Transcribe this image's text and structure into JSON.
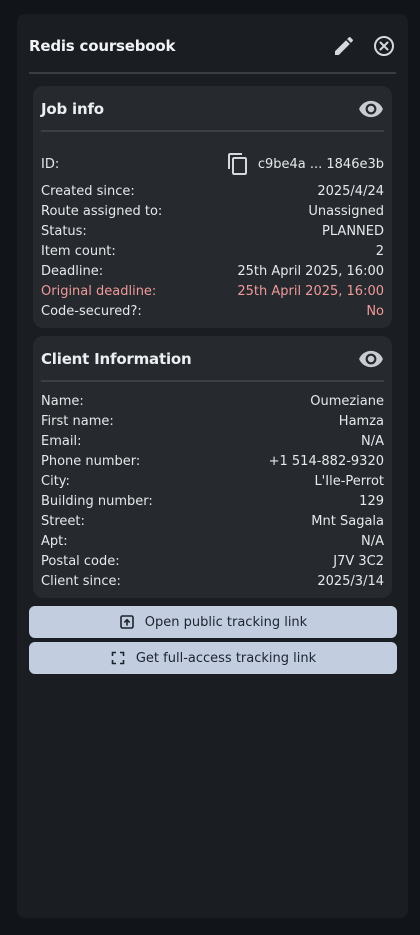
{
  "panel": {
    "title": "Redis coursebook",
    "icons": [
      "pencil-icon",
      "close-circle-icon"
    ]
  },
  "job_info": {
    "title": "Job info",
    "id_label": "ID:",
    "id_value": "c9be4a ... 1846e3b",
    "created_label": "Created since:",
    "created_value": "2025/4/24",
    "route_label": "Route assigned to:",
    "route_value": "Unassigned",
    "status_label": "Status:",
    "status_value": "PLANNED",
    "items_label": "Item count:",
    "items_value": "2",
    "deadline_label": "Deadline:",
    "deadline_value": "25th April 2025, 16:00",
    "orig_deadline_label": "Original deadline:",
    "orig_deadline_value": "25th April 2025, 16:00",
    "code_label": "Code-secured?:",
    "code_value": "No"
  },
  "client_info": {
    "title": "Client Information",
    "name_label": "Name:",
    "name_value": "Oumeziane",
    "first_label": "First name:",
    "first_value": "Hamza",
    "email_label": "Email:",
    "email_value": "N/A",
    "phone_label": "Phone number:",
    "phone_value": "+1 514-882-9320",
    "city_label": "City:",
    "city_value": "L'Ile-Perrot",
    "building_label": "Building number:",
    "building_value": "129",
    "street_label": "Street:",
    "street_value": "Mnt Sagala",
    "apt_label": "Apt:",
    "apt_value": "N/A",
    "postal_label": "Postal code:",
    "postal_value": "J7V 3C2",
    "since_label": "Client since:",
    "since_value": "2025/3/14"
  },
  "actions": {
    "public_link": "Open public tracking link",
    "full_link": "Get full-access tracking link"
  },
  "colors": {
    "accent_button": "#c2cee0",
    "warning_text": "#ef9a9a"
  }
}
